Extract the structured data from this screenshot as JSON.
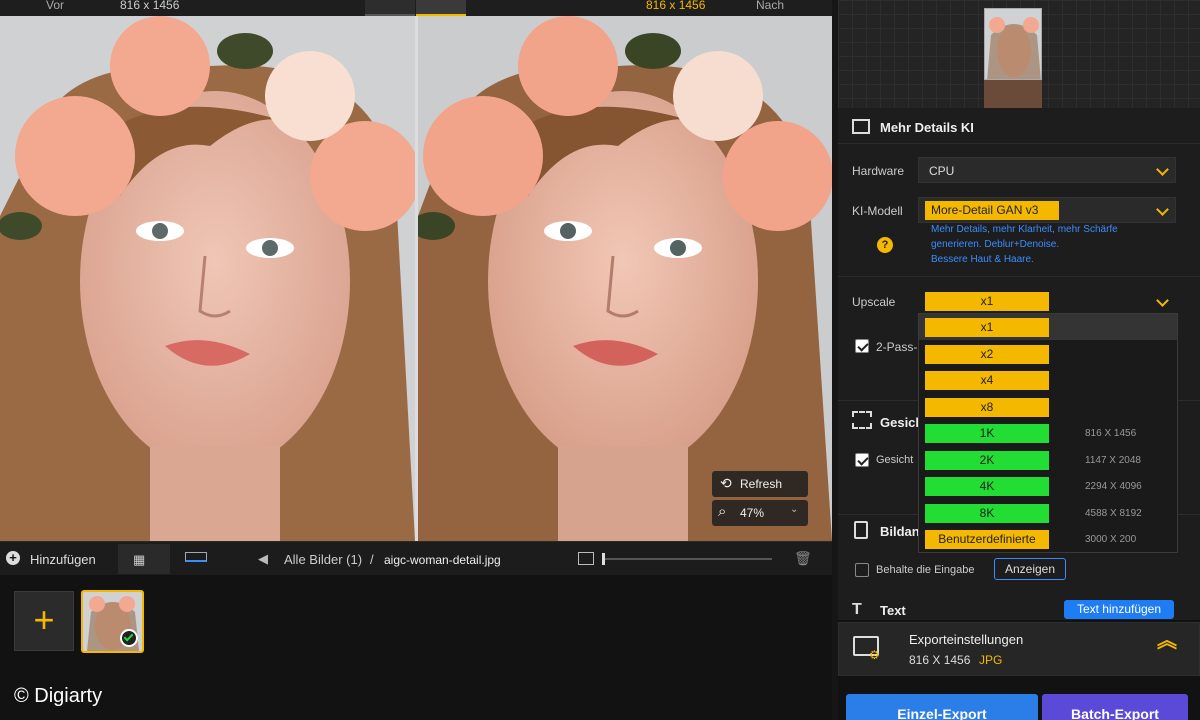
{
  "topbar": {
    "before_label": "Vor",
    "before_size": "816 x 1456",
    "after_size": "816 x 1456",
    "after_label": "Nach"
  },
  "viewer": {
    "refresh_label": "Refresh",
    "zoom_value": "47%"
  },
  "toolbar": {
    "add_label": "Hinzufügen",
    "breadcrumb_all": "Alle Bilder (1)",
    "breadcrumb_sep": "/",
    "filename": "aigc-woman-detail.jpg"
  },
  "watermark": "© Digiarty",
  "panel": {
    "section_title": "Mehr Details KI",
    "hardware_label": "Hardware",
    "hardware_value": "CPU",
    "model_label": "KI-Modell",
    "model_value": "More-Detail GAN  v3",
    "model_desc_1": "Mehr Details, mehr Klarheit, mehr Schärfe",
    "model_desc_2": "generieren. Deblur+Denoise.",
    "model_desc_3": "Bessere Haut & Haare.",
    "upscale_label": "Upscale",
    "upscale_value": "x1",
    "twopass_label": "2-Pass-",
    "face_section": "Gesich",
    "face_checkbox": "Gesicht",
    "image_section": "Bildan",
    "keep_input": "Behalte die Eingabe",
    "show_button": "Anzeigen",
    "text_section": "Text",
    "add_text_button": "Text hinzufügen",
    "export_title": "Exporteinstellungen",
    "export_size": "816 X 1456",
    "export_format": "JPG",
    "single_export": "Einzel-Export",
    "batch_export": "Batch-Export"
  },
  "upscale_options": [
    {
      "label": "x1",
      "dim": ""
    },
    {
      "label": "x2",
      "dim": ""
    },
    {
      "label": "x4",
      "dim": ""
    },
    {
      "label": "x8",
      "dim": ""
    },
    {
      "label": "1K",
      "dim": "816 X 1456"
    },
    {
      "label": "2K",
      "dim": "1147 X 2048"
    },
    {
      "label": "4K",
      "dim": "2294 X 4096"
    },
    {
      "label": "8K",
      "dim": "4588 X 8192"
    },
    {
      "label": "Benutzerdefinierte",
      "dim": "3000 X 200"
    }
  ],
  "colors": {
    "accent": "#f5b800",
    "green": "#22dd33",
    "blue": "#1e7cf5",
    "link": "#3b8cff"
  }
}
